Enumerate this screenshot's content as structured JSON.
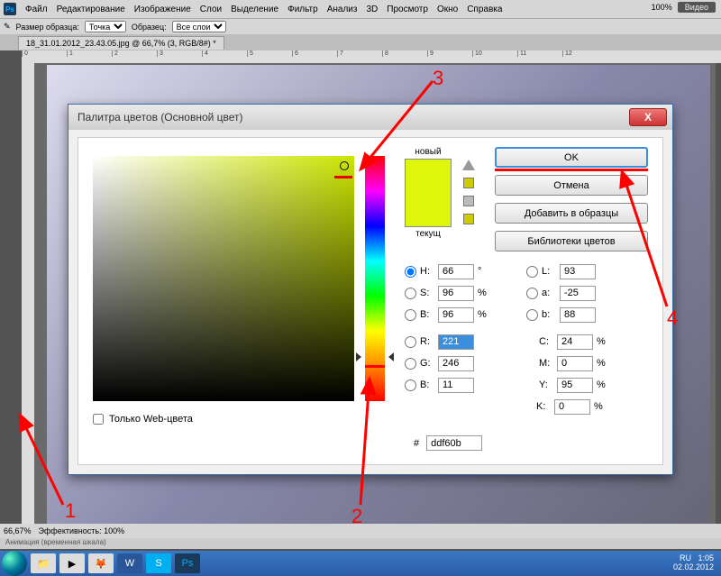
{
  "menubar": {
    "items": [
      "Файл",
      "Редактирование",
      "Изображение",
      "Слои",
      "Выделение",
      "Фильтр",
      "Анализ",
      "3D",
      "Просмотр",
      "Окно",
      "Справка"
    ],
    "zoom": "100%",
    "video_label": "Видео"
  },
  "optbar": {
    "label_size": "Размер образца:",
    "size_value": "Точка",
    "label_sample": "Образец:",
    "sample_value": "Все слои"
  },
  "tab": {
    "title": "18_31.01.2012_23.43.05.jpg @ 66,7% (3, RGB/8#) *"
  },
  "ruler_ticks": [
    "0",
    "1",
    "2",
    "3",
    "4",
    "5",
    "6",
    "7",
    "8",
    "9",
    "10",
    "11",
    "12"
  ],
  "status": {
    "zoom": "66,67%",
    "eff": "Эффективность: 100%"
  },
  "anim_panel": "Анимация (временная шкала)",
  "dialog": {
    "title": "Палитра цветов (Основной цвет)",
    "close": "X",
    "new_label": "новый",
    "cur_label": "текущ",
    "web_only": "Только Web-цвета",
    "buttons": {
      "ok": "OK",
      "cancel": "Отмена",
      "add": "Добавить в образцы",
      "libs": "Библиотеки цветов"
    },
    "hsb": {
      "Hlabel": "H:",
      "H": "66",
      "Hdeg": "°",
      "Slabel": "S:",
      "S": "96",
      "Blabel": "B:",
      "B": "96",
      "pct": "%"
    },
    "rgb": {
      "Rlabel": "R:",
      "R": "221",
      "Glabel": "G:",
      "G": "246",
      "Blabel": "B:",
      "B": "11"
    },
    "lab": {
      "Llabel": "L:",
      "L": "93",
      "alabel": "a:",
      "a": "-25",
      "blabel": "b:",
      "b": "88"
    },
    "cmyk": {
      "Clabel": "C:",
      "C": "24",
      "Mlabel": "M:",
      "M": "0",
      "Ylabel": "Y:",
      "Y": "95",
      "Klabel": "K:",
      "K": "0",
      "pct": "%"
    },
    "hex": {
      "label": "#",
      "value": "ddf60b"
    }
  },
  "taskbar": {
    "lang": "RU",
    "time": "1:05",
    "date": "02.02.2012"
  },
  "annotations": {
    "n1": "1",
    "n2": "2",
    "n3": "3",
    "n4": "4"
  },
  "chart_data": null
}
